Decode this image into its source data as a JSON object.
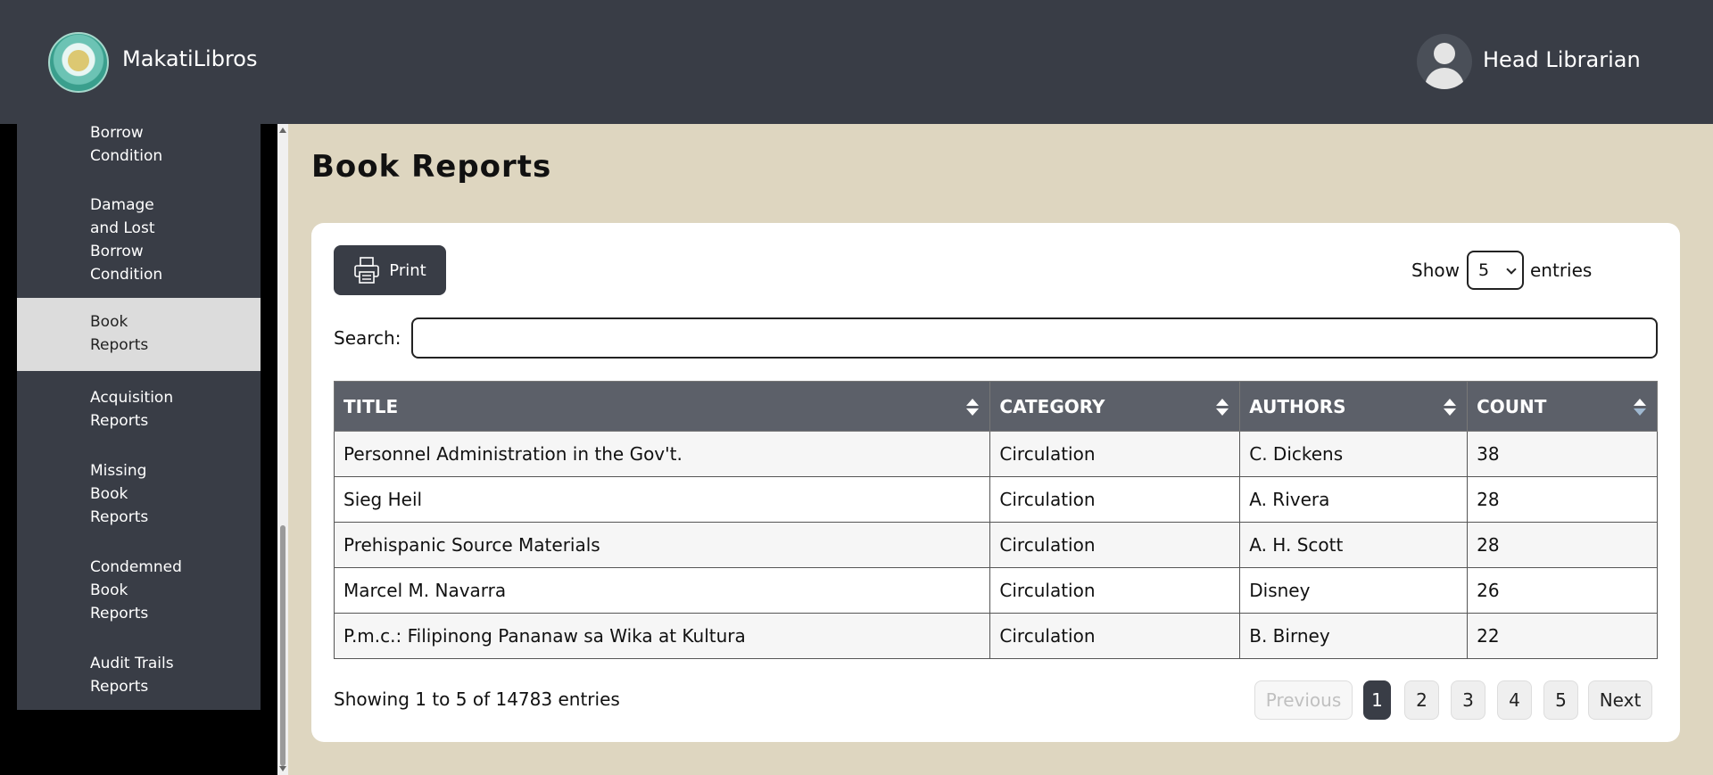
{
  "header": {
    "app_name": "MakatiLibros",
    "user_name": "Head Librarian"
  },
  "sidebar": {
    "items": [
      {
        "lines": [
          "Borrow",
          "Condition"
        ]
      },
      {
        "lines": [
          "Damage",
          "and Lost",
          "Borrow",
          "Condition"
        ]
      },
      {
        "lines": [
          "Book",
          "Reports"
        ],
        "active": true
      },
      {
        "lines": [
          "Acquisition",
          "Reports"
        ]
      },
      {
        "lines": [
          "Missing",
          "Book",
          "Reports"
        ]
      },
      {
        "lines": [
          "Condemned",
          "Book",
          "Reports"
        ]
      },
      {
        "lines": [
          "Audit Trails",
          "Reports"
        ]
      }
    ]
  },
  "main": {
    "title": "Book Reports",
    "print_label": "Print",
    "show_label": "Show",
    "entries_value": "5",
    "entries_label": "entries",
    "search_label": "Search:",
    "search_value": "",
    "table": {
      "headers": [
        "TITLE",
        "CATEGORY",
        "AUTHORS",
        "COUNT"
      ],
      "rows": [
        [
          "Personnel Administration in the Gov't.",
          "Circulation",
          "C. Dickens",
          "38"
        ],
        [
          "Sieg Heil",
          "Circulation",
          "A. Rivera",
          "28"
        ],
        [
          "Prehispanic Source Materials",
          "Circulation",
          "A. H. Scott",
          "28"
        ],
        [
          "Marcel M. Navarra",
          "Circulation",
          "Disney",
          "26"
        ],
        [
          "P.m.c.: Filipinong Pananaw sa Wika at Kultura",
          "Circulation",
          "B. Birney",
          "22"
        ]
      ]
    },
    "info": "Showing 1 to 5 of 14783 entries",
    "pagination": {
      "previous": "Previous",
      "pages": [
        "1",
        "2",
        "3",
        "4",
        "5"
      ],
      "current": "1",
      "next": "Next"
    }
  },
  "colors": {
    "header_bg": "#393d46",
    "main_bg": "#ded6c0",
    "table_header_bg": "#5c6069",
    "active_item_bg": "#dcdcdc"
  }
}
